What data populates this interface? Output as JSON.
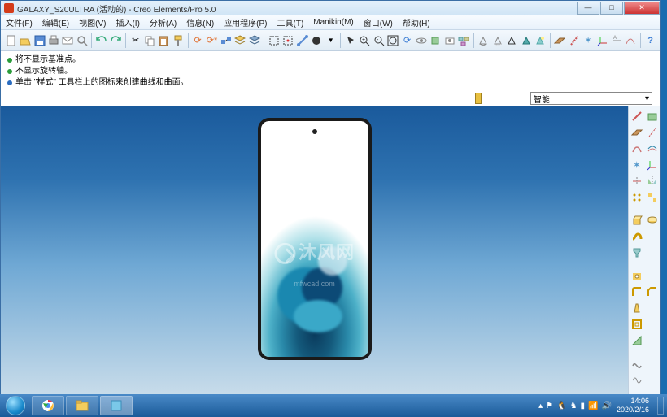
{
  "titlebar": {
    "text": "GALAXY_S20ULTRA (活动的) - Creo Elements/Pro 5.0"
  },
  "menu": {
    "file": "文件(F)",
    "edit": "编辑(E)",
    "view": "视图(V)",
    "insert": "插入(I)",
    "analysis": "分析(A)",
    "info": "信息(N)",
    "app": "应用程序(P)",
    "tools": "工具(T)",
    "manikin": "Manikin(M)",
    "window": "窗口(W)",
    "help": "帮助(H)"
  },
  "messages": {
    "m1": "将不显示基准点。",
    "m2": "不显示旋转轴。",
    "m3": "单击 \"样式\" 工具栏上的图标来创建曲线和曲面。"
  },
  "filter": {
    "label": "智能",
    "arrow": "▾"
  },
  "watermark": {
    "main": "沐风网",
    "sub": "mfwcad.com"
  },
  "taskbar": {
    "time": "14:06",
    "date": "2020/2/16"
  },
  "showdesktop": "▮"
}
